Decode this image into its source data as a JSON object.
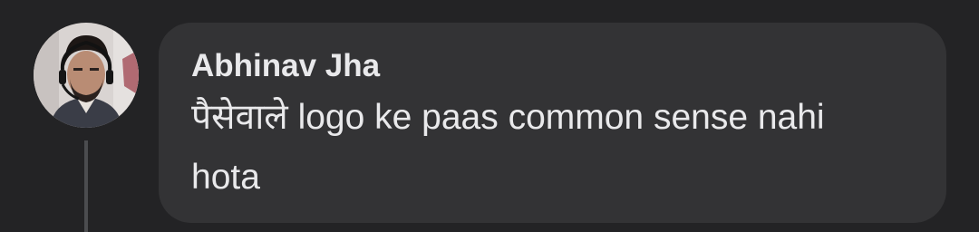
{
  "comment": {
    "author": "Abhinav Jha",
    "text": "पैसेवाले logo ke paas common sense nahi hota"
  },
  "colors": {
    "background": "#232325",
    "bubble": "#333335",
    "text": "#e9e9eb",
    "thread_line": "#4b4c4f"
  }
}
